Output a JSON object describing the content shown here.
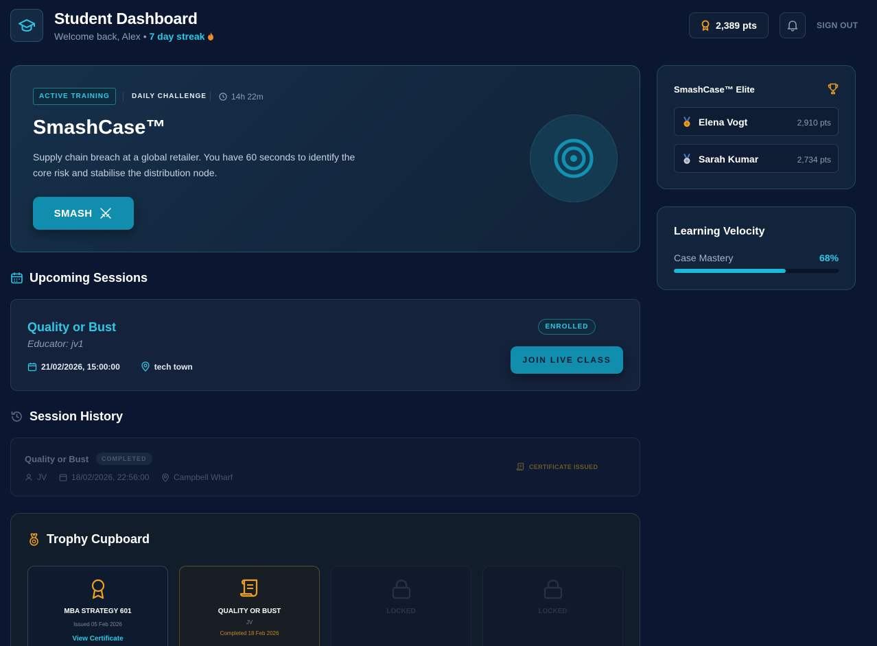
{
  "header": {
    "title": "Student Dashboard",
    "welcome": "Welcome back, Alex",
    "separator": "•",
    "streak": "7 day streak",
    "points": "2,389 pts",
    "sign_out": "SIGN OUT"
  },
  "challenge": {
    "tag": "ACTIVE TRAINING",
    "type": "DAILY CHALLENGE",
    "timer": "14h 22m",
    "title": "SmashCase™",
    "description": "Supply chain breach at a global retailer. You have 60 seconds to identify the core risk and stabilise the distribution node.",
    "button": "SMASH"
  },
  "upcoming": {
    "heading": "Upcoming Sessions",
    "session": {
      "title": "Quality or Bust",
      "educator": "Educator: jv1",
      "datetime": "21/02/2026, 15:00:00",
      "location": "tech town",
      "status": "ENROLLED",
      "button": "JOIN LIVE CLASS"
    }
  },
  "history": {
    "heading": "Session History",
    "item": {
      "title": "Quality or Bust",
      "status": "COMPLETED",
      "educator": "JV",
      "datetime": "18/02/2026, 22:56:00",
      "location": "Campbell Wharf",
      "certificate": "CERTIFICATE ISSUED"
    }
  },
  "trophies": {
    "heading": "Trophy Cupboard",
    "items": [
      {
        "name": "MBA STRATEGY 601",
        "sub": "Issued 05 Feb 2026",
        "link": "View Certificate",
        "icon": "award-ribbon-icon"
      },
      {
        "name": "QUALITY OR BUST",
        "sub": "JV",
        "date": "Completed 18 Feb 2026",
        "icon": "scroll-icon"
      },
      {
        "name": "LOCKED",
        "icon": "lock-icon"
      },
      {
        "name": "LOCKED",
        "icon": "lock-icon"
      }
    ]
  },
  "leaderboard": {
    "title": "SmashCase™ Elite",
    "rows": [
      {
        "name": "Elena Vogt",
        "points": "2,910 pts",
        "medal": "gold"
      },
      {
        "name": "Sarah Kumar",
        "points": "2,734 pts",
        "medal": "silver"
      }
    ]
  },
  "velocity": {
    "title": "Learning Velocity",
    "label": "Case Mastery",
    "value": "68%",
    "progress": 0.68
  },
  "colors": {
    "background": "#0b1730",
    "accent": "#2fc7e6",
    "button": "#118eae",
    "gold": "#f0a020"
  }
}
